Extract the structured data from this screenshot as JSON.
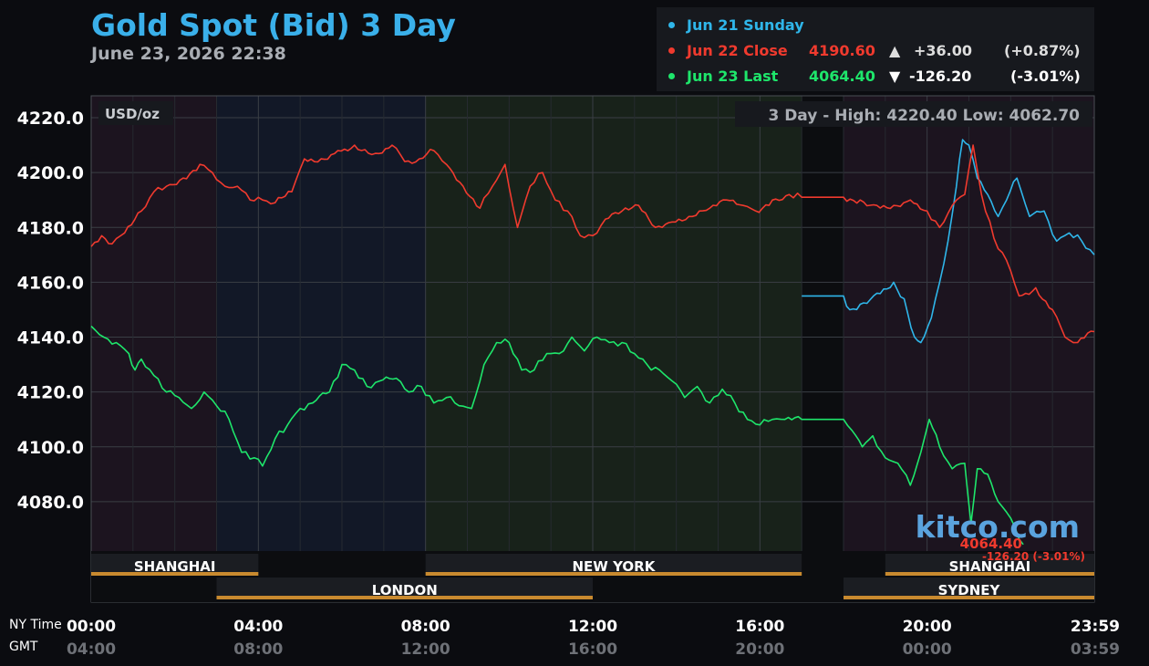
{
  "title": "Gold Spot (Bid) 3 Day",
  "subtitle": "June 23, 2026 22:38",
  "legend": [
    {
      "label": "Jun 21 Sunday",
      "price": "",
      "arrow": "",
      "change": "",
      "pct": "",
      "color": "#2fb6ea"
    },
    {
      "label": "Jun 22 Close",
      "price": "4190.60",
      "arrow": "▲",
      "change": "+36.00",
      "pct": "(+0.87%)",
      "color": "#f03a2e"
    },
    {
      "label": "Jun 23 Last",
      "price": "4064.40",
      "arrow": "▼",
      "change": "-126.20",
      "pct": "(-3.01%)",
      "color": "#1ee66b"
    }
  ],
  "unit_label": "USD/oz",
  "high_low": "3 Day - High: 4220.40  Low: 4062.70",
  "logo": "kitco.com",
  "last_price_label": "4064.40",
  "last_change_label": "-126.20 (-3.01%)",
  "ny_time_label": "NY Time",
  "gmt_label": "GMT",
  "sessions": [
    {
      "name": "SHANGHAI",
      "start": 0,
      "end": 4
    },
    {
      "name": "NEW YORK",
      "start": 8,
      "end": 17
    },
    {
      "name": "SHANGHAI",
      "start": 19,
      "end": 24
    },
    {
      "name": "LONDON",
      "start": 3,
      "end": 12
    },
    {
      "name": "SYDNEY",
      "start": 18,
      "end": 24
    }
  ],
  "session_colors": {
    "bar": "#c98a2f",
    "asia": "#1c141f",
    "london": "#121827",
    "newyork": "#18221a",
    "closed": "#0c0d10"
  },
  "chart_data": {
    "type": "line",
    "x_label_ny": [
      "00:00",
      "04:00",
      "08:00",
      "12:00",
      "16:00",
      "20:00",
      "23:59"
    ],
    "x_label_gmt": [
      "04:00",
      "08:00",
      "12:00",
      "16:00",
      "20:00",
      "00:00",
      "03:59"
    ],
    "x_tick_hours": [
      0,
      4,
      8,
      12,
      16,
      20,
      24
    ],
    "xlim": [
      0,
      24
    ],
    "ylim": [
      4062,
      4228
    ],
    "y_ticks": [
      4080,
      4100,
      4120,
      4140,
      4160,
      4180,
      4200,
      4220
    ],
    "y_tick_labels": [
      "4080.0",
      "4100.0",
      "4120.0",
      "4140.0",
      "4160.0",
      "4180.0",
      "4200.0",
      "4220.0"
    ],
    "grid": true,
    "high": 4220.4,
    "low": 4062.7,
    "series": [
      {
        "name": "Jun 21 Sunday",
        "color": "#2fb6ea",
        "x": [
          17.0,
          18.0,
          18.15,
          18.4,
          18.8,
          19.2,
          19.45,
          19.7,
          19.85,
          20.1,
          20.3,
          20.5,
          20.7,
          20.85,
          21.0,
          21.2,
          21.45,
          21.7,
          21.9,
          22.15,
          22.45,
          22.8,
          23.1,
          23.4,
          23.7,
          24.0
        ],
        "y": [
          4155,
          4155,
          4150,
          4152,
          4156,
          4160,
          4154,
          4140,
          4138,
          4147,
          4160,
          4175,
          4195,
          4212,
          4210,
          4198,
          4192,
          4184,
          4190,
          4198,
          4184,
          4186,
          4175,
          4178,
          4175,
          4170
        ]
      },
      {
        "name": "Jun 22 Close",
        "color": "#f03a2e",
        "x": [
          0,
          0.25,
          0.5,
          0.8,
          1.2,
          1.5,
          1.8,
          2.2,
          2.6,
          2.9,
          3.2,
          3.5,
          3.8,
          4.1,
          4.4,
          4.8,
          5.1,
          5.5,
          5.9,
          6.3,
          6.8,
          7.2,
          7.5,
          7.85,
          8.2,
          8.5,
          8.9,
          9.3,
          9.6,
          9.9,
          10.2,
          10.5,
          10.8,
          11.1,
          11.4,
          11.7,
          12.0,
          12.3,
          12.7,
          13.1,
          13.5,
          13.9,
          14.3,
          14.8,
          15.2,
          15.6,
          15.9,
          16.3,
          16.7,
          17.0,
          18.0,
          18.4,
          18.8,
          19.2,
          19.6,
          20.0,
          20.3,
          20.6,
          20.9,
          21.1,
          21.3,
          21.6,
          21.9,
          22.2,
          22.6,
          23.0,
          23.3,
          23.6,
          24.0
        ],
        "y": [
          4173,
          4177,
          4174,
          4178,
          4186,
          4193,
          4195,
          4198,
          4203,
          4200,
          4195,
          4195,
          4190,
          4190,
          4189,
          4193,
          4205,
          4205,
          4208,
          4210,
          4207,
          4210,
          4204,
          4205,
          4208,
          4203,
          4195,
          4187,
          4195,
          4203,
          4180,
          4195,
          4200,
          4190,
          4186,
          4177,
          4177,
          4183,
          4186,
          4188,
          4180,
          4182,
          4184,
          4187,
          4190,
          4188,
          4186,
          4190,
          4192,
          4191,
          4191,
          4190,
          4188,
          4188,
          4190,
          4186,
          4180,
          4188,
          4192,
          4210,
          4192,
          4176,
          4168,
          4155,
          4158,
          4150,
          4140,
          4138,
          4142
        ]
      },
      {
        "name": "Jun 23 Last",
        "color": "#1ee66b",
        "x": [
          0,
          0.3,
          0.6,
          0.9,
          1.05,
          1.2,
          1.5,
          1.8,
          2.1,
          2.4,
          2.7,
          3.0,
          3.3,
          3.6,
          3.9,
          4.1,
          4.4,
          4.7,
          5.0,
          5.3,
          5.7,
          6.0,
          6.3,
          6.6,
          6.9,
          7.3,
          7.6,
          7.9,
          8.2,
          8.5,
          8.8,
          9.1,
          9.4,
          9.7,
          10.0,
          10.3,
          10.6,
          10.9,
          11.2,
          11.5,
          11.8,
          12.1,
          12.4,
          12.7,
          13.0,
          13.3,
          13.6,
          13.9,
          14.2,
          14.5,
          14.8,
          15.1,
          15.4,
          15.7,
          16.0,
          16.3,
          16.6,
          17.0,
          18.0,
          18.2,
          18.45,
          18.7,
          19.0,
          19.3,
          19.6,
          19.85,
          20.05,
          20.3,
          20.6,
          20.9,
          21.05,
          21.2,
          21.45,
          21.7,
          22.0,
          22.3
        ],
        "y": [
          4144,
          4140,
          4138,
          4134,
          4128,
          4132,
          4126,
          4120,
          4118,
          4114,
          4120,
          4115,
          4110,
          4098,
          4096,
          4093,
          4103,
          4108,
          4114,
          4116,
          4120,
          4130,
          4128,
          4122,
          4124,
          4125,
          4120,
          4122,
          4116,
          4118,
          4115,
          4114,
          4130,
          4138,
          4138,
          4128,
          4128,
          4134,
          4134,
          4140,
          4135,
          4140,
          4138,
          4138,
          4134,
          4130,
          4128,
          4124,
          4118,
          4122,
          4116,
          4121,
          4116,
          4110,
          4108,
          4110,
          4110,
          4110,
          4110,
          4106,
          4100,
          4104,
          4096,
          4094,
          4086,
          4098,
          4110,
          4100,
          4092,
          4094,
          4072,
          4092,
          4090,
          4080,
          4074,
          4064.4
        ]
      }
    ]
  }
}
